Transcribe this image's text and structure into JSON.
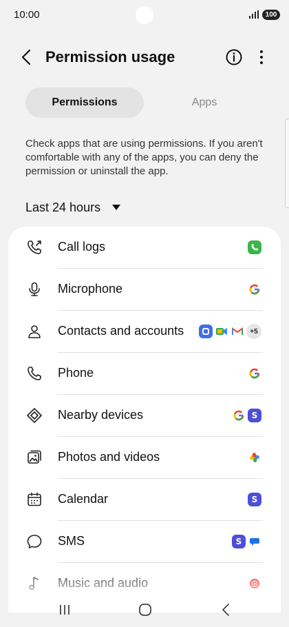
{
  "status_bar": {
    "time": "10:00",
    "battery": "100"
  },
  "app_bar": {
    "title": "Permission usage"
  },
  "tabs": [
    {
      "label": "Permissions",
      "active": true
    },
    {
      "label": "Apps",
      "active": false
    }
  ],
  "description": "Check apps that are using permissions. If you aren't comfortable with any of the apps, you can deny the permission or uninstall the app.",
  "filter": {
    "selected": "Last 24 hours"
  },
  "permissions": [
    {
      "label": "Call logs",
      "icon": "call-log-icon",
      "apps": [
        "phone-app-icon"
      ]
    },
    {
      "label": "Microphone",
      "icon": "microphone-icon",
      "apps": [
        "google-app-icon"
      ]
    },
    {
      "label": "Contacts and accounts",
      "icon": "person-icon",
      "apps": [
        "meet-app-icon",
        "duo-app-icon",
        "gmail-app-icon"
      ],
      "more": "+5"
    },
    {
      "label": "Phone",
      "icon": "phone-icon",
      "apps": [
        "google-app-icon"
      ]
    },
    {
      "label": "Nearby devices",
      "icon": "nearby-devices-icon",
      "apps": [
        "google-app-icon",
        "samsung-s-app-icon"
      ]
    },
    {
      "label": "Photos and videos",
      "icon": "photos-icon",
      "apps": [
        "google-photos-app-icon"
      ]
    },
    {
      "label": "Calendar",
      "icon": "calendar-icon",
      "apps": [
        "samsung-s-app-icon"
      ]
    },
    {
      "label": "SMS",
      "icon": "sms-icon",
      "apps": [
        "samsung-s-app-icon",
        "messages-app-icon"
      ]
    },
    {
      "label": "Music and audio",
      "icon": "music-icon",
      "apps": [
        "youtube-music-app-icon"
      ]
    }
  ],
  "colors": {
    "background": "#f2f2f2",
    "card": "#ffffff",
    "active_tab": "#e3e3e3",
    "samsung_s": "#4f4fd6",
    "phone_green": "#3bb54a"
  }
}
